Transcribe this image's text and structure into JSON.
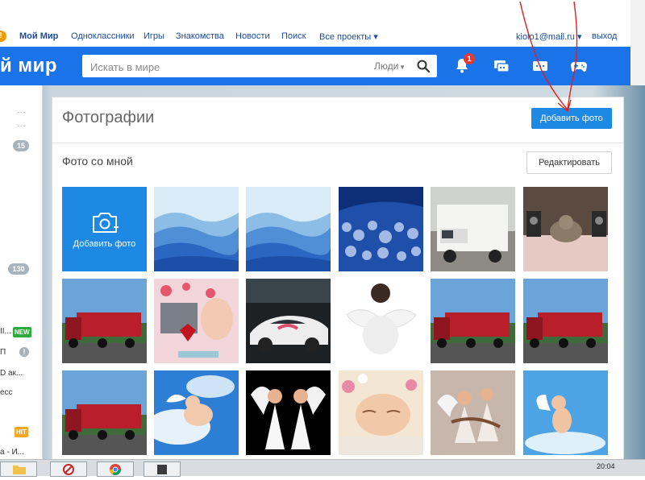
{
  "top_nav": {
    "warn": "!",
    "brand": "Мой Мир",
    "items": [
      "Одноклассники",
      "Игры",
      "Знакомства",
      "Новости",
      "Поиск",
      "Все проекты"
    ],
    "account": "kiolo1@mail.ru",
    "logout": "выход"
  },
  "header": {
    "logo": "й мир",
    "search_placeholder": "Искать в мире",
    "search_scope": "Люди",
    "notifications_count": "1",
    "icons": [
      "search-icon",
      "bell-icon",
      "chat-icon",
      "messages-icon",
      "gamepad-icon"
    ]
  },
  "left_panel": {
    "dots": [
      "...",
      "..."
    ],
    "counts": [
      "15",
      "130"
    ],
    "labels": [
      "II...",
      "П",
      "D ак...",
      "есс",
      "а - И..."
    ],
    "tags": {
      "new": "NEW",
      "hit": "HIT"
    },
    "colors": {
      "new": "#2eaa3c",
      "hit": "#f5a623",
      "pill": "#a8b4bd"
    }
  },
  "main": {
    "title": "Фотографии",
    "add_photo_button": "Добавить фото",
    "section_title": "Фото со мной",
    "edit_button": "Редактировать",
    "add_tile_label": "Добавить фото",
    "photos": [
      "blue mountains",
      "blue mountains",
      "snowy forest",
      "white truck",
      "cat with speakers",
      "red truck",
      "collage with hearts",
      "white sports car",
      "angel child",
      "red truck",
      "red truck",
      "red truck",
      "cherub in clouds",
      "two angels",
      "sleeping baby",
      "children angels",
      "cherub on blue"
    ]
  },
  "taskbar": {
    "clock": "20:04"
  },
  "colors": {
    "accent": "#1a73e8",
    "button": "#1e88e5",
    "badge": "#e53935",
    "annotation": "#e02020"
  }
}
